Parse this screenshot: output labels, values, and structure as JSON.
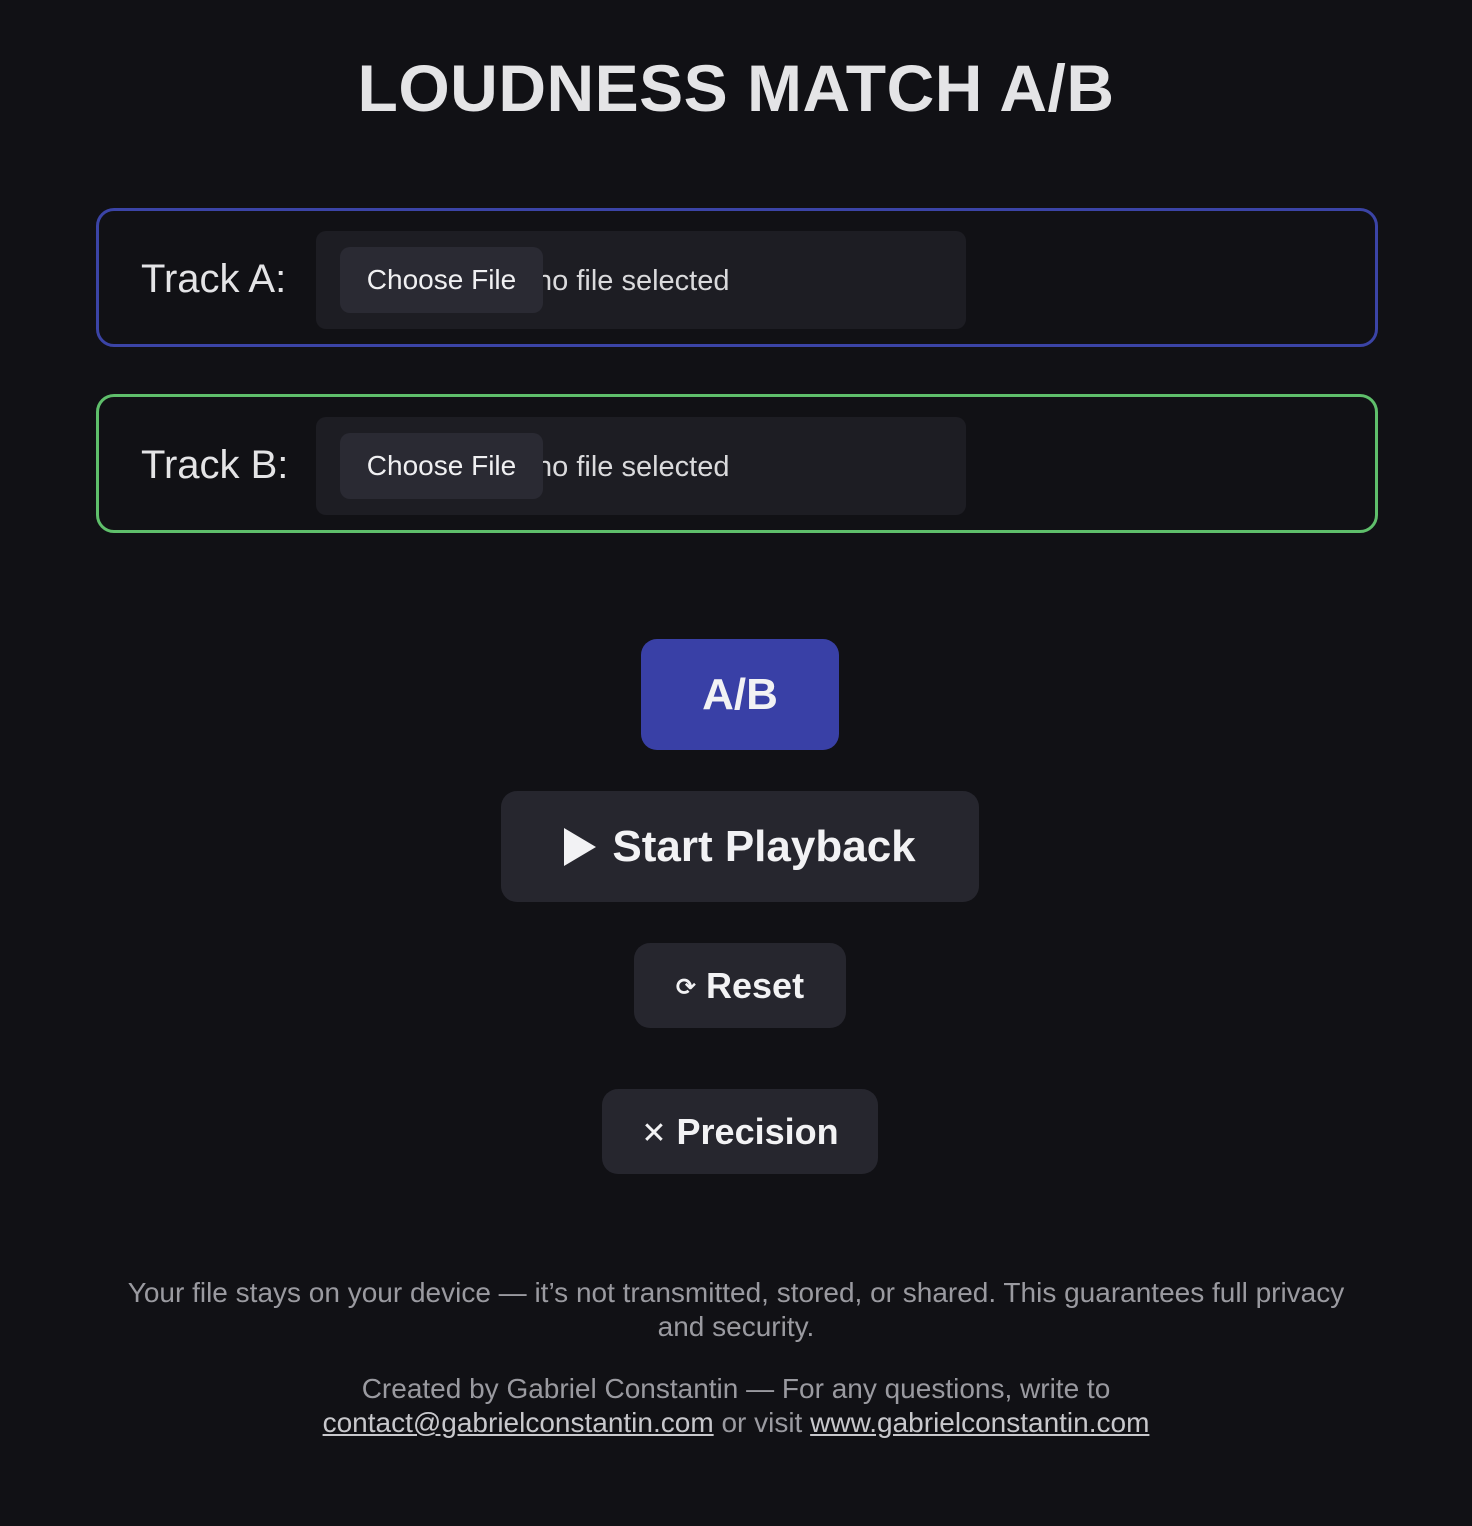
{
  "header": {
    "title": "LOUDNESS MATCH A/B"
  },
  "tracks": {
    "a": {
      "label": "Track A:",
      "button_label": "Choose File",
      "status": "no file selected",
      "color": "#3b44a6"
    },
    "b": {
      "label": "Track B:",
      "button_label": "Choose File",
      "status": "no file selected",
      "color": "#5fbf6b"
    }
  },
  "controls": {
    "ab_label": "A/B",
    "ab_color": "#3940a6",
    "play_label": "Start Playback",
    "play_icon": "play-icon",
    "reset_label": "Reset",
    "reset_icon_glyph": "⟳",
    "precision_label": "Precision",
    "precision_icon_glyph": "✕"
  },
  "footer": {
    "privacy": "Your file stays on your device — it’s not transmitted, stored, or shared. This guarantees full privacy and security.",
    "credits_prefix": "Created by Gabriel Constantin — For any questions, write to",
    "email": "contact@gabrielconstantin.com",
    "or_visit": "or visit",
    "website": "www.gabrielconstantin.com"
  }
}
